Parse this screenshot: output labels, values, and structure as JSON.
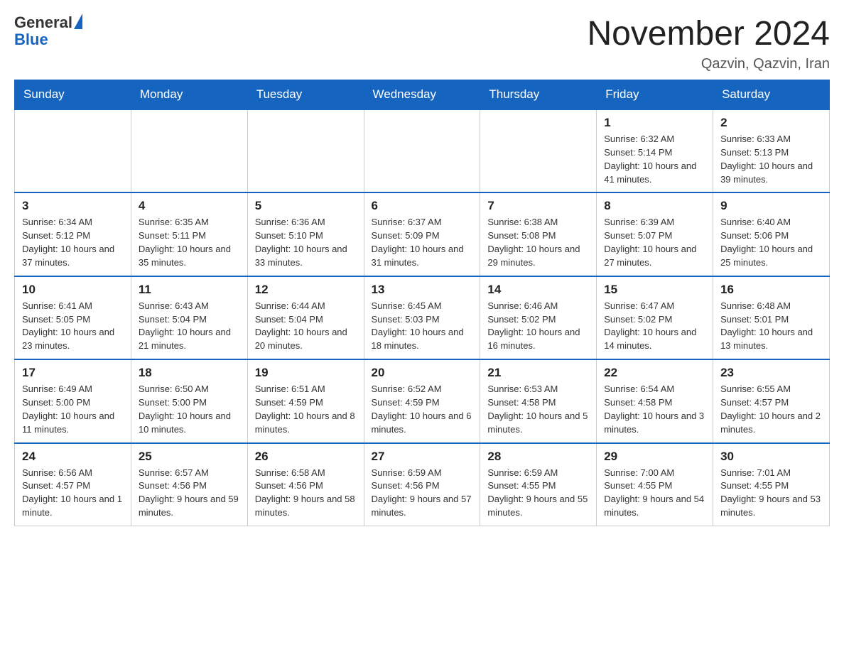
{
  "header": {
    "logo_general": "General",
    "logo_blue": "Blue",
    "month_title": "November 2024",
    "location": "Qazvin, Qazvin, Iran"
  },
  "days_of_week": [
    "Sunday",
    "Monday",
    "Tuesday",
    "Wednesday",
    "Thursday",
    "Friday",
    "Saturday"
  ],
  "weeks": [
    {
      "days": [
        {
          "number": "",
          "info": ""
        },
        {
          "number": "",
          "info": ""
        },
        {
          "number": "",
          "info": ""
        },
        {
          "number": "",
          "info": ""
        },
        {
          "number": "",
          "info": ""
        },
        {
          "number": "1",
          "info": "Sunrise: 6:32 AM\nSunset: 5:14 PM\nDaylight: 10 hours and 41 minutes."
        },
        {
          "number": "2",
          "info": "Sunrise: 6:33 AM\nSunset: 5:13 PM\nDaylight: 10 hours and 39 minutes."
        }
      ]
    },
    {
      "days": [
        {
          "number": "3",
          "info": "Sunrise: 6:34 AM\nSunset: 5:12 PM\nDaylight: 10 hours and 37 minutes."
        },
        {
          "number": "4",
          "info": "Sunrise: 6:35 AM\nSunset: 5:11 PM\nDaylight: 10 hours and 35 minutes."
        },
        {
          "number": "5",
          "info": "Sunrise: 6:36 AM\nSunset: 5:10 PM\nDaylight: 10 hours and 33 minutes."
        },
        {
          "number": "6",
          "info": "Sunrise: 6:37 AM\nSunset: 5:09 PM\nDaylight: 10 hours and 31 minutes."
        },
        {
          "number": "7",
          "info": "Sunrise: 6:38 AM\nSunset: 5:08 PM\nDaylight: 10 hours and 29 minutes."
        },
        {
          "number": "8",
          "info": "Sunrise: 6:39 AM\nSunset: 5:07 PM\nDaylight: 10 hours and 27 minutes."
        },
        {
          "number": "9",
          "info": "Sunrise: 6:40 AM\nSunset: 5:06 PM\nDaylight: 10 hours and 25 minutes."
        }
      ]
    },
    {
      "days": [
        {
          "number": "10",
          "info": "Sunrise: 6:41 AM\nSunset: 5:05 PM\nDaylight: 10 hours and 23 minutes."
        },
        {
          "number": "11",
          "info": "Sunrise: 6:43 AM\nSunset: 5:04 PM\nDaylight: 10 hours and 21 minutes."
        },
        {
          "number": "12",
          "info": "Sunrise: 6:44 AM\nSunset: 5:04 PM\nDaylight: 10 hours and 20 minutes."
        },
        {
          "number": "13",
          "info": "Sunrise: 6:45 AM\nSunset: 5:03 PM\nDaylight: 10 hours and 18 minutes."
        },
        {
          "number": "14",
          "info": "Sunrise: 6:46 AM\nSunset: 5:02 PM\nDaylight: 10 hours and 16 minutes."
        },
        {
          "number": "15",
          "info": "Sunrise: 6:47 AM\nSunset: 5:02 PM\nDaylight: 10 hours and 14 minutes."
        },
        {
          "number": "16",
          "info": "Sunrise: 6:48 AM\nSunset: 5:01 PM\nDaylight: 10 hours and 13 minutes."
        }
      ]
    },
    {
      "days": [
        {
          "number": "17",
          "info": "Sunrise: 6:49 AM\nSunset: 5:00 PM\nDaylight: 10 hours and 11 minutes."
        },
        {
          "number": "18",
          "info": "Sunrise: 6:50 AM\nSunset: 5:00 PM\nDaylight: 10 hours and 10 minutes."
        },
        {
          "number": "19",
          "info": "Sunrise: 6:51 AM\nSunset: 4:59 PM\nDaylight: 10 hours and 8 minutes."
        },
        {
          "number": "20",
          "info": "Sunrise: 6:52 AM\nSunset: 4:59 PM\nDaylight: 10 hours and 6 minutes."
        },
        {
          "number": "21",
          "info": "Sunrise: 6:53 AM\nSunset: 4:58 PM\nDaylight: 10 hours and 5 minutes."
        },
        {
          "number": "22",
          "info": "Sunrise: 6:54 AM\nSunset: 4:58 PM\nDaylight: 10 hours and 3 minutes."
        },
        {
          "number": "23",
          "info": "Sunrise: 6:55 AM\nSunset: 4:57 PM\nDaylight: 10 hours and 2 minutes."
        }
      ]
    },
    {
      "days": [
        {
          "number": "24",
          "info": "Sunrise: 6:56 AM\nSunset: 4:57 PM\nDaylight: 10 hours and 1 minute."
        },
        {
          "number": "25",
          "info": "Sunrise: 6:57 AM\nSunset: 4:56 PM\nDaylight: 9 hours and 59 minutes."
        },
        {
          "number": "26",
          "info": "Sunrise: 6:58 AM\nSunset: 4:56 PM\nDaylight: 9 hours and 58 minutes."
        },
        {
          "number": "27",
          "info": "Sunrise: 6:59 AM\nSunset: 4:56 PM\nDaylight: 9 hours and 57 minutes."
        },
        {
          "number": "28",
          "info": "Sunrise: 6:59 AM\nSunset: 4:55 PM\nDaylight: 9 hours and 55 minutes."
        },
        {
          "number": "29",
          "info": "Sunrise: 7:00 AM\nSunset: 4:55 PM\nDaylight: 9 hours and 54 minutes."
        },
        {
          "number": "30",
          "info": "Sunrise: 7:01 AM\nSunset: 4:55 PM\nDaylight: 9 hours and 53 minutes."
        }
      ]
    }
  ]
}
